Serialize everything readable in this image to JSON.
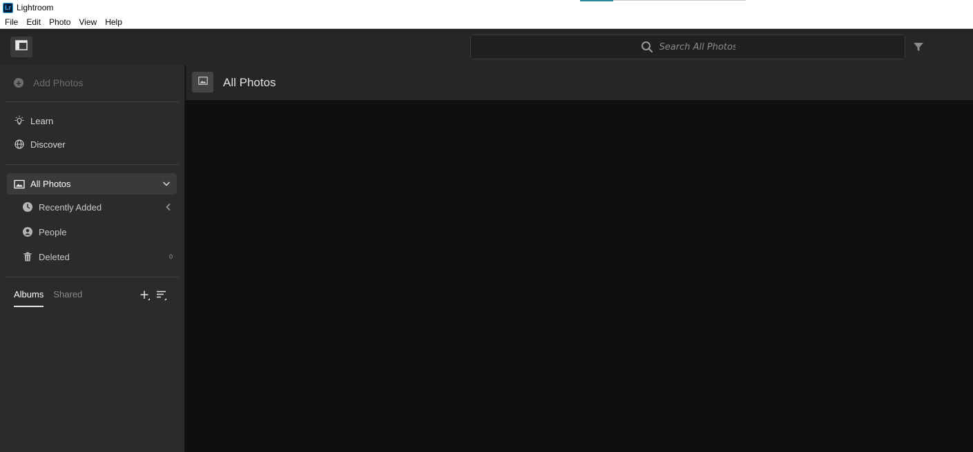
{
  "window": {
    "app_logo_text": "Lr",
    "title": "Lightroom"
  },
  "menubar": {
    "items": [
      "File",
      "Edit",
      "Photo",
      "View",
      "Help"
    ]
  },
  "toolbar": {
    "panel_toggle_icon": "sidebar-toggle-icon",
    "search_placeholder": "Search All Photos",
    "filter_icon": "filter-icon"
  },
  "sidebar": {
    "add_photos_label": "Add Photos",
    "primary_nav": [
      {
        "label": "Learn",
        "icon": "lightbulb-icon"
      },
      {
        "label": "Discover",
        "icon": "globe-icon"
      }
    ],
    "all_photos": {
      "label": "All Photos",
      "icon": "photo-icon",
      "expanded": true
    },
    "sub_items": [
      {
        "label": "Recently Added",
        "icon": "clock-icon",
        "trailing": "chevron-left-icon"
      },
      {
        "label": "People",
        "icon": "person-icon"
      },
      {
        "label": "Deleted",
        "icon": "trash-icon",
        "count": "0"
      }
    ],
    "tabs": [
      {
        "label": "Albums",
        "active": true
      },
      {
        "label": "Shared",
        "active": false
      }
    ]
  },
  "main": {
    "title": "All Photos",
    "title_icon": "photo-icon"
  },
  "colors": {
    "sidebar_bg": "#2b2b2b",
    "toolbar_bg": "#262626",
    "grid_bg": "#0f0f0f",
    "selected_row_bg": "#3a3a3a"
  }
}
